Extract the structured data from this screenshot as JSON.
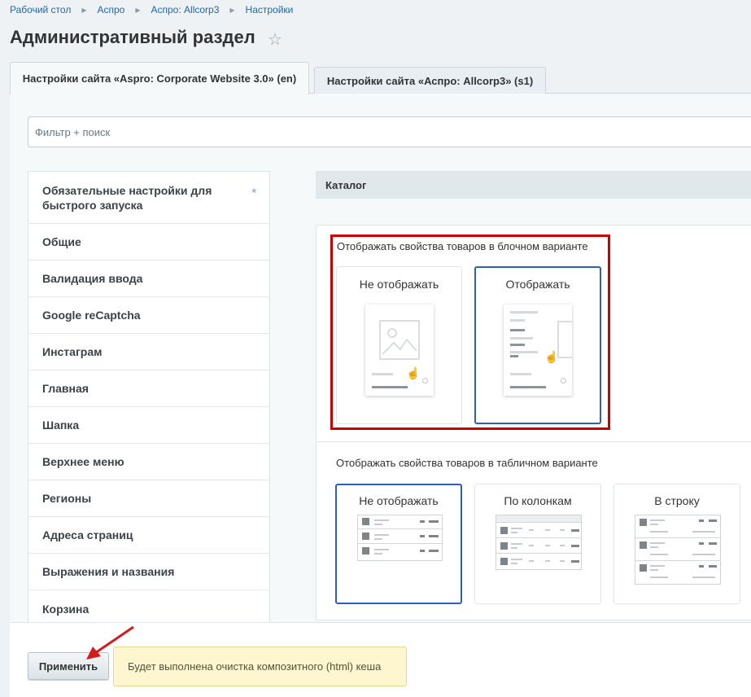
{
  "breadcrumb": [
    "Рабочий стол",
    "Аспро",
    "Аспро: Allcorp3",
    "Настройки"
  ],
  "page_title": "Административный раздел",
  "tabs": [
    {
      "label": "Настройки сайта «Aspro: Corporate Website 3.0» (en)",
      "active": true
    },
    {
      "label": "Настройки сайта «Аспро: Allcorp3» (s1)",
      "active": false
    }
  ],
  "filter": {
    "placeholder": "Фильтр + поиск"
  },
  "sidebar": {
    "items": [
      {
        "label": "Обязательные настройки для быстрого запуска"
      },
      {
        "label": "Общие"
      },
      {
        "label": "Валидация ввода"
      },
      {
        "label": "Google reCaptcha"
      },
      {
        "label": "Инстаграм"
      },
      {
        "label": "Главная"
      },
      {
        "label": "Шапка"
      },
      {
        "label": "Верхнее меню"
      },
      {
        "label": "Регионы"
      },
      {
        "label": "Адреса страниц"
      },
      {
        "label": "Выражения и названия"
      },
      {
        "label": "Корзина"
      }
    ]
  },
  "section": {
    "title": "Каталог"
  },
  "block_group": {
    "title": "Отображать свойства товаров в блочном варианте",
    "options": [
      {
        "label": "Не отображать",
        "selected": false
      },
      {
        "label": "Отображать",
        "selected": true
      }
    ]
  },
  "table_group": {
    "title": "Отображать свойства товаров в табличном варианте",
    "options": [
      {
        "label": "Не отображать",
        "selected": true
      },
      {
        "label": "По колонкам",
        "selected": false
      },
      {
        "label": "В строку",
        "selected": false
      }
    ]
  },
  "footer": {
    "apply_label": "Применить",
    "notice": "Будет выполнена очистка композитного (html) кеша"
  },
  "colors": {
    "accent": "#2d5eb8",
    "highlight": "#cc0000",
    "notice_bg": "#fdf6cf"
  }
}
